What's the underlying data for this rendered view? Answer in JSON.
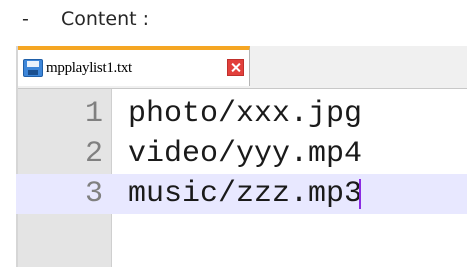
{
  "heading": {
    "bullet": "-",
    "text": "Content :"
  },
  "editor": {
    "tab": {
      "icon": "save-file-icon",
      "filename": "mpplaylist1.txt",
      "close_icon": "close-icon"
    },
    "lines": [
      {
        "number": "1",
        "text": "photo/xxx.jpg"
      },
      {
        "number": "2",
        "text": "video/yyy.mp4"
      },
      {
        "number": "3",
        "text": "music/zzz.mp3"
      }
    ],
    "current_line": 3
  },
  "colors": {
    "tab_accent": "#f5a623",
    "current_line_highlight": "#e8e8ff",
    "close_button": "#e2403c",
    "caret": "#8a2be2"
  }
}
